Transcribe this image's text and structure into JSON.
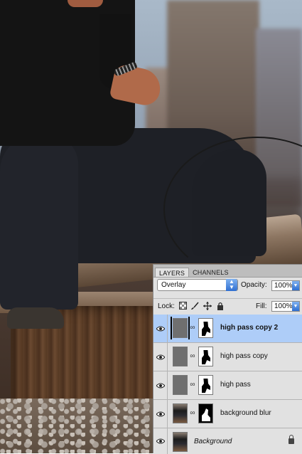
{
  "panel": {
    "tabs": [
      {
        "label": "LAYERS",
        "active": true
      },
      {
        "label": "CHANNELS",
        "active": false
      }
    ],
    "blend_mode": "Overlay",
    "opacity_label": "Opacity:",
    "opacity_value": "100%",
    "lock_label": "Lock:",
    "fill_label": "Fill:",
    "fill_value": "100%",
    "layers": [
      {
        "name": "high pass copy 2",
        "selected": true,
        "style": "bold"
      },
      {
        "name": "high pass copy",
        "selected": false,
        "style": "normal"
      },
      {
        "name": "high pass",
        "selected": false,
        "style": "normal"
      },
      {
        "name": "background blur",
        "selected": false,
        "style": "normal"
      },
      {
        "name": "Background",
        "selected": false,
        "style": "italic",
        "locked": true
      }
    ]
  },
  "icons": {
    "visibility": "eye-icon",
    "link": "chain-link-icon",
    "lock_transparent": "checkerboard-lock-icon",
    "lock_image": "brush-lock-icon",
    "lock_position": "move-lock-icon",
    "lock_all": "padlock-icon"
  },
  "colors": {
    "selected_row": "#aecdf8",
    "panel_bg": "#e1e1e1",
    "accent": "#2f6fd1"
  }
}
